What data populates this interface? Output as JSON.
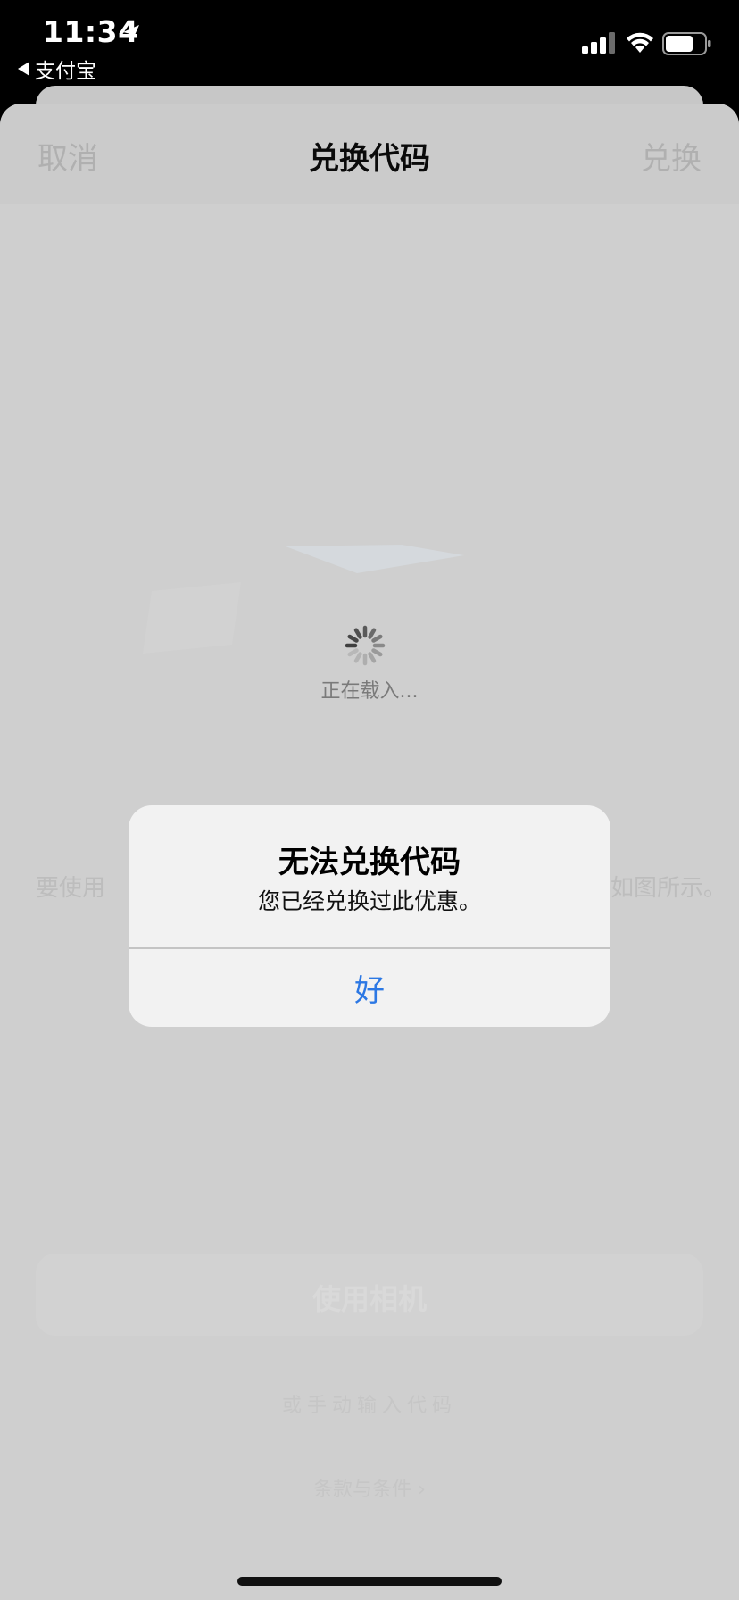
{
  "status_bar": {
    "time": "11:34",
    "back_app": "支付宝"
  },
  "nav": {
    "cancel": "取消",
    "title": "兑换代码",
    "redeem": "兑换"
  },
  "background": {
    "loading_text": "正在载入...",
    "desc_left": "要使用",
    "desc_right": "如图所示。",
    "button_label": "使用相机",
    "line_text": "或手动输入代码",
    "terms": "条款与条件 ›"
  },
  "alert": {
    "title": "无法兑换代码",
    "message": "您已经兑换过此优惠。",
    "ok": "好"
  },
  "colors": {
    "accent": "#2c78e4",
    "sheet_background": "#cfcfcf",
    "alert_background": "#f2f2f2"
  }
}
